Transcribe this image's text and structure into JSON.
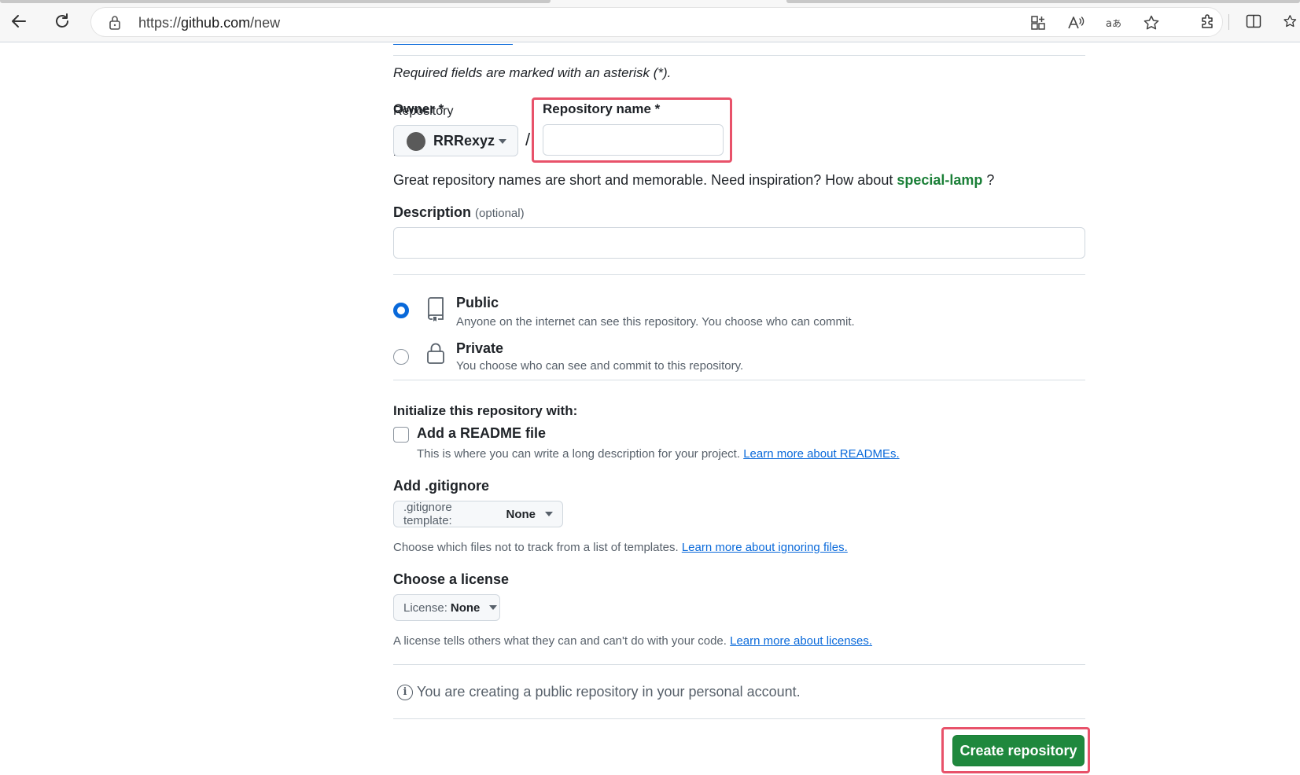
{
  "browser": {
    "url_scheme": "https://",
    "url_host": "github.com",
    "url_path": "/new",
    "icons": [
      "back-arrow-icon",
      "reload-icon",
      "lock-icon",
      "app-grid-icon",
      "read-aloud-icon",
      "translate-icon",
      "favorite-star-icon",
      "extensions-icon",
      "split-screen-icon"
    ]
  },
  "form": {
    "required_note": "Required fields are marked with an asterisk (*).",
    "owner_label": "Owner *",
    "owner_overlay_label": "Repository owner and name",
    "owner_value": "RRRexyz",
    "slash": "/",
    "repo_name_label": "Repository name *",
    "repo_name_value": "",
    "suggestion_prefix": "Great repository names are short and memorable. Need inspiration? How about",
    "suggestion_name": "special-lamp",
    "suggestion_suffix": "?",
    "description_label": "Description",
    "description_optional": "(optional)",
    "description_value": ""
  },
  "visibility": {
    "public_title": "Public",
    "public_desc": "Anyone on the internet can see this repository. You choose who can commit.",
    "private_title": "Private",
    "private_desc": "You choose who can see and commit to this repository.",
    "selected": "public"
  },
  "initialize": {
    "label": "Initialize this repository with:",
    "readme_title": "Add a README file",
    "readme_desc": "This is where you can write a long description for your project.",
    "readme_link": "Learn more about READMEs.",
    "readme_checked": false
  },
  "gitignore": {
    "label": "Add .gitignore",
    "select_prefix": ".gitignore template:",
    "select_value": "None",
    "help": "Choose which files not to track from a list of templates.",
    "help_link": "Learn more about ignoring files."
  },
  "license": {
    "label": "Choose a license",
    "select_prefix": "License:",
    "select_value": "None",
    "help": "A license tells others what they can and can't do with your code.",
    "help_link": "Learn more about licenses."
  },
  "footer": {
    "info_text": "You are creating a public repository in your personal account.",
    "create_button": "Create repository"
  },
  "colors": {
    "accent_blue": "#0969da",
    "primary_green": "#1f883d",
    "suggestion_green": "#1a7f37",
    "highlight_red": "#e8526a"
  }
}
